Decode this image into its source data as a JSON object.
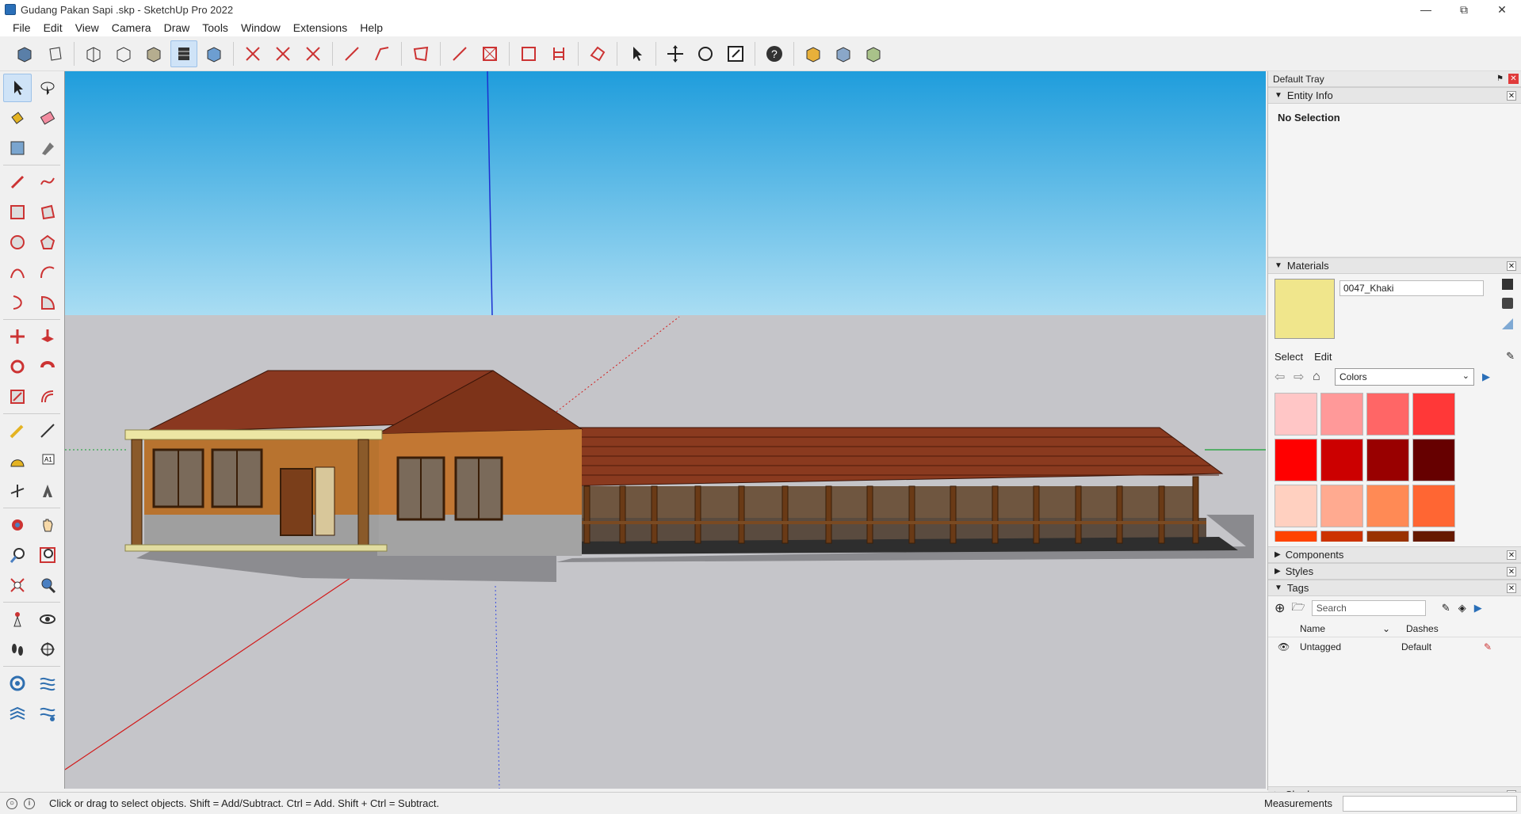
{
  "window": {
    "title": "Gudang Pakan Sapi .skp - SketchUp Pro 2022"
  },
  "menu": [
    "File",
    "Edit",
    "View",
    "Camera",
    "Draw",
    "Tools",
    "Window",
    "Extensions",
    "Help"
  ],
  "tray": {
    "title": "Default Tray",
    "entity_info": {
      "label": "Entity Info",
      "value": "No Selection"
    },
    "materials": {
      "label": "Materials",
      "name": "0047_Khaki",
      "swatch_color": "#f0e68c",
      "tabs": [
        "Select",
        "Edit"
      ],
      "collection": "Colors",
      "colors": [
        "#ffc6c6",
        "#ff9999",
        "#ff6666",
        "#ff3838",
        "#ff0000",
        "#cc0000",
        "#990000",
        "#660000",
        "#ffd0c0",
        "#ffaa90",
        "#ff8a55",
        "#ff6633",
        "#ff4400",
        "#cc3300",
        "#993300",
        "#661a00"
      ]
    },
    "components": {
      "label": "Components"
    },
    "styles": {
      "label": "Styles"
    },
    "tags": {
      "label": "Tags",
      "search_placeholder": "Search",
      "col_name": "Name",
      "col_dashes": "Dashes",
      "rows": [
        {
          "name": "Untagged",
          "dashes": "Default"
        }
      ]
    },
    "shadows": {
      "label": "Shadows"
    }
  },
  "status": {
    "message": "Click or drag to select objects. Shift = Add/Subtract. Ctrl = Add. Shift + Ctrl = Subtract.",
    "measurements_label": "Measurements"
  }
}
